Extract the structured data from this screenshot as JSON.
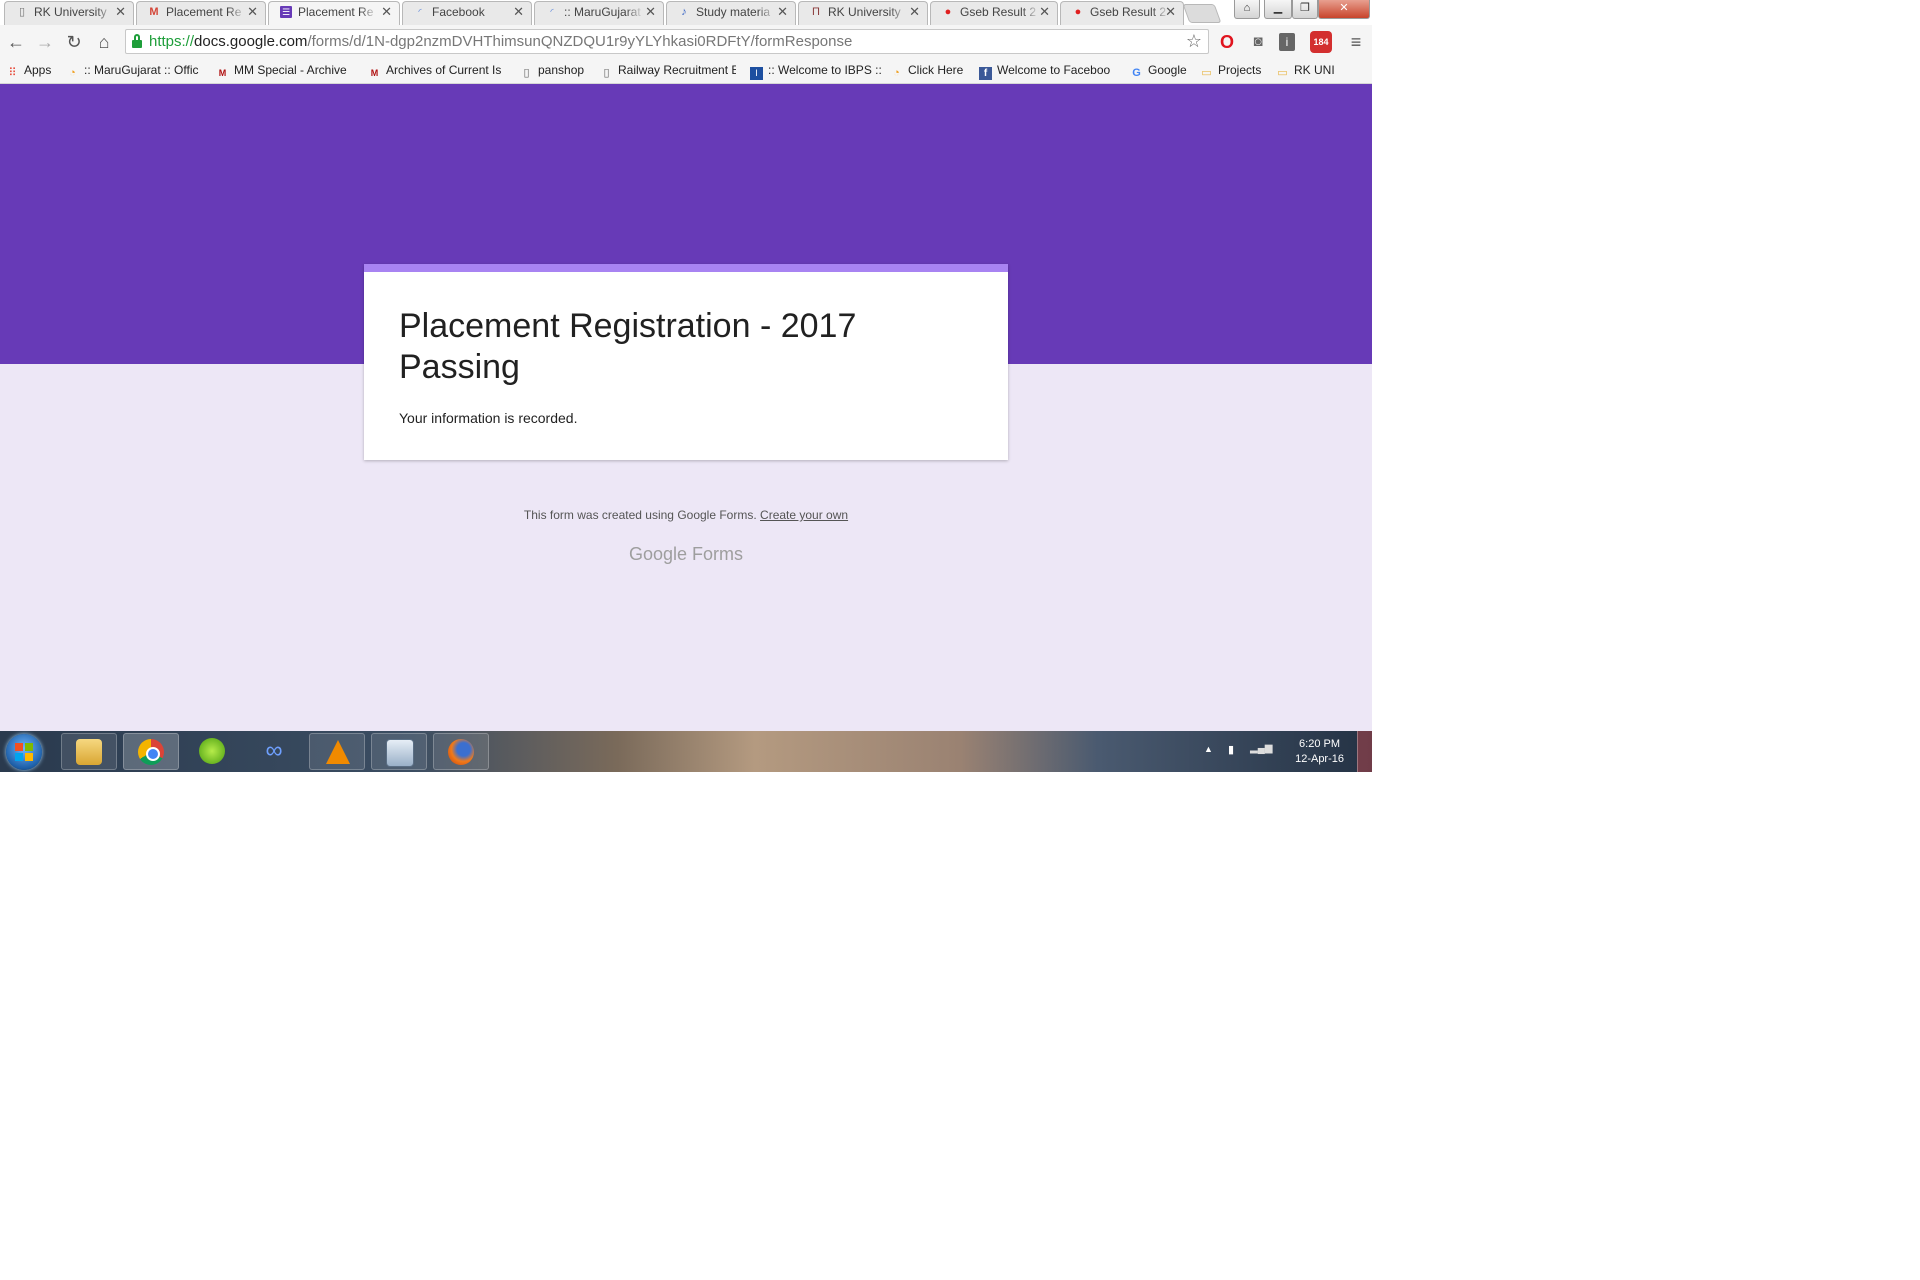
{
  "browser": {
    "tabs": [
      {
        "title": "RK University",
        "icon": "document-icon"
      },
      {
        "title": "Placement Re",
        "icon": "gmail-icon"
      },
      {
        "title": "Placement Re",
        "icon": "forms-icon",
        "active": true
      },
      {
        "title": "Facebook",
        "icon": "loading-icon"
      },
      {
        "title": ":: MaruGujarat",
        "icon": "loading-icon"
      },
      {
        "title": "Study materia",
        "icon": "music-note-icon"
      },
      {
        "title": "RK University",
        "icon": "rk-icon"
      },
      {
        "title": "Gseb Result 2",
        "icon": "gseb-icon"
      },
      {
        "title": "Gseb Result 2",
        "icon": "gseb-icon"
      }
    ],
    "url": {
      "scheme": "https://",
      "host": "docs.google.com",
      "path": "/forms/d/1N-dgp2nzmDVHThimsunQNZDQU1r9yYLYhkasi0RDFtY/formResponse"
    },
    "extension_badge": "184",
    "bookmarks": [
      {
        "label": "Apps",
        "icon": "apps-grid-icon"
      },
      {
        "label": ":: MaruGujarat :: Offic",
        "icon": "marugujarat-icon"
      },
      {
        "label": "MM Special - Archive",
        "icon": "mm-icon"
      },
      {
        "label": "Archives of Current Is",
        "icon": "mm-icon"
      },
      {
        "label": "panshop",
        "icon": "page-icon"
      },
      {
        "label": "Railway Recruitment E",
        "icon": "page-icon"
      },
      {
        "label": ":: Welcome to IBPS ::",
        "icon": "ibps-icon"
      },
      {
        "label": "Click Here",
        "icon": "marugujarat-icon"
      },
      {
        "label": "Welcome to Faceboo",
        "icon": "facebook-icon"
      },
      {
        "label": "Google",
        "icon": "google-icon"
      },
      {
        "label": "Projects",
        "icon": "folder-icon"
      },
      {
        "label": "RK UNI",
        "icon": "folder-icon"
      }
    ]
  },
  "form": {
    "title": "Placement Registration - 2017 Passing",
    "confirmation": "Your information is recorded.",
    "footer_text": "This form was created using Google Forms.",
    "footer_link": "Create your own",
    "brand_google": "Google",
    "brand_forms": "Forms",
    "colors": {
      "header": "#673ab7",
      "card_accent": "#a883f2",
      "background": "#ede7f6"
    }
  },
  "taskbar": {
    "time": "6:20 PM",
    "date": "12-Apr-16",
    "apps": [
      "explorer-icon",
      "chrome-icon",
      "green-app-icon",
      "infinity-icon",
      "vlc-icon",
      "calculator-icon",
      "firefox-icon"
    ]
  }
}
